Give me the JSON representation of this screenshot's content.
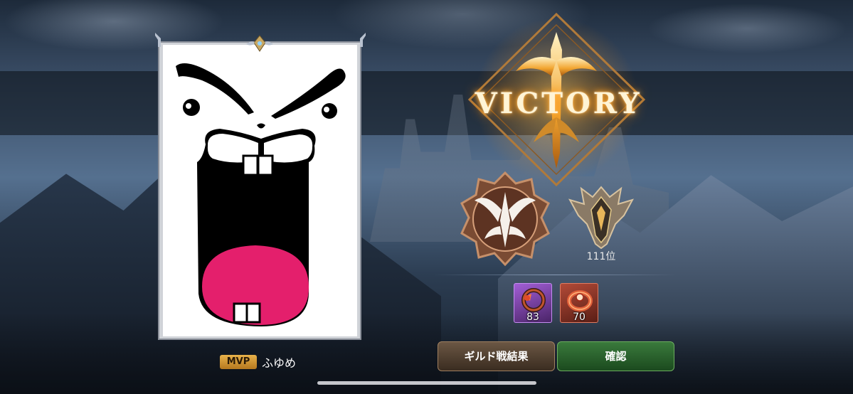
{
  "result": {
    "title": "VICTORY"
  },
  "rewards": {
    "rank_label": "111位",
    "items": [
      {
        "icon": "bracelet-icon",
        "count": "83",
        "rarity_color": "#a25ed6"
      },
      {
        "icon": "ring-icon",
        "count": "70",
        "rarity_color": "#b24a37"
      }
    ]
  },
  "buttons": {
    "guild_result": "ギルド戦結果",
    "confirm": "確認"
  },
  "mvp": {
    "badge": "MVP",
    "player_name": "ふゆめ"
  },
  "colors": {
    "victory_glow": "#ff8a00",
    "confirm_green": "#3a7a3c",
    "mvp_gold": "#e8b24a"
  }
}
